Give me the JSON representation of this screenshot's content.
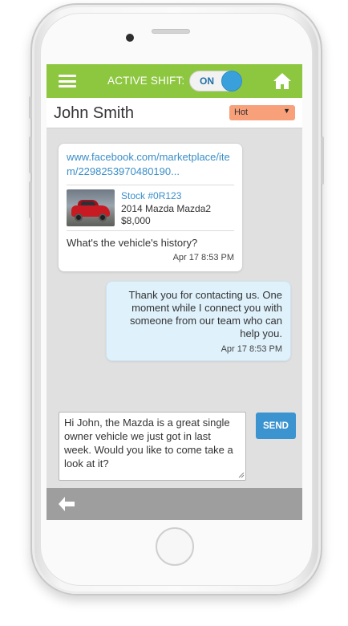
{
  "topbar": {
    "active_shift_label": "ACTIVE SHIFT:",
    "toggle_label": "ON",
    "menu_icon": "hamburger-menu-icon",
    "home_icon": "home-icon",
    "color": "#8dc63f"
  },
  "contact": {
    "name": "John Smith",
    "status": "Hot",
    "status_color": "#f7a07a"
  },
  "messages": {
    "incoming": {
      "link": "www.facebook.com/marketplace/item/2298253970480190...",
      "stock": "Stock #0R123",
      "vehicle": "2014 Mazda Mazda2",
      "price": "$8,000",
      "text": "What's the vehicle's history?",
      "time": "Apr 17 8:53 PM"
    },
    "outgoing": {
      "text": "Thank you for contacting us. One moment while I connect you with someone from our team who can help you.",
      "time": "Apr 17 8:53 PM"
    }
  },
  "compose": {
    "value": "Hi John, the Mazda is a great single owner vehicle we just got in last week. Would you like to come take a look at it?",
    "send_label": "SEND"
  },
  "bottombar": {
    "back_icon": "back-arrow-icon"
  }
}
